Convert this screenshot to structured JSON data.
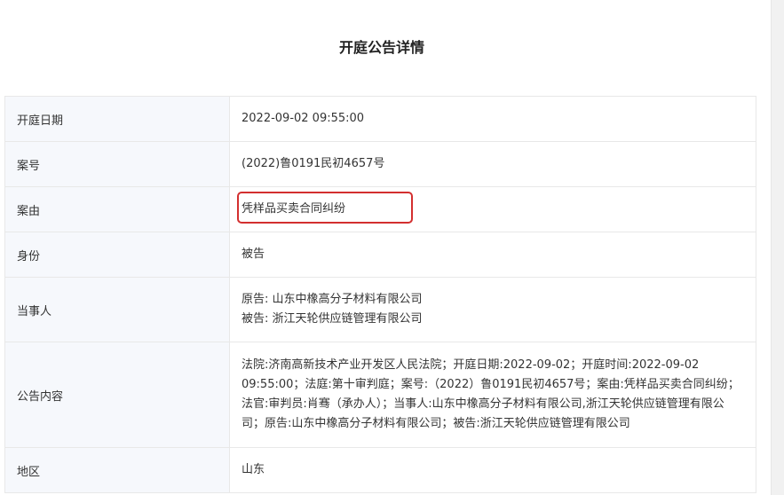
{
  "page": {
    "title": "开庭公告详情"
  },
  "rows": [
    {
      "label": "开庭日期",
      "value": "2022-09-02 09:55:00"
    },
    {
      "label": "案号",
      "value": "(2022)鲁0191民初4657号"
    },
    {
      "label": "案由",
      "value": "凭样品买卖合同纠纷"
    },
    {
      "label": "身份",
      "value": "被告"
    },
    {
      "label": "当事人",
      "value_lines": [
        "原告: 山东中橡高分子材料有限公司",
        "被告: 浙江天轮供应链管理有限公司"
      ]
    },
    {
      "label": "公告内容",
      "value": "法院:济南高新技术产业开发区人民法院；开庭日期:2022-09-02；开庭时间:2022-09-02 09:55:00；法庭:第十审判庭；案号:（2022）鲁0191民初4657号；案由:凭样品买卖合同纠纷；法官:审判员:肖骞（承办人）；当事人:山东中橡高分子材料有限公司,浙江天轮供应链管理有限公司；原告:山东中橡高分子材料有限公司；被告:浙江天轮供应链管理有限公司"
    },
    {
      "label": "地区",
      "value": "山东"
    }
  ],
  "colors": {
    "label_bg": "#f6f8fc",
    "border": "#e8e8e8",
    "highlight": "#d32f2f"
  }
}
